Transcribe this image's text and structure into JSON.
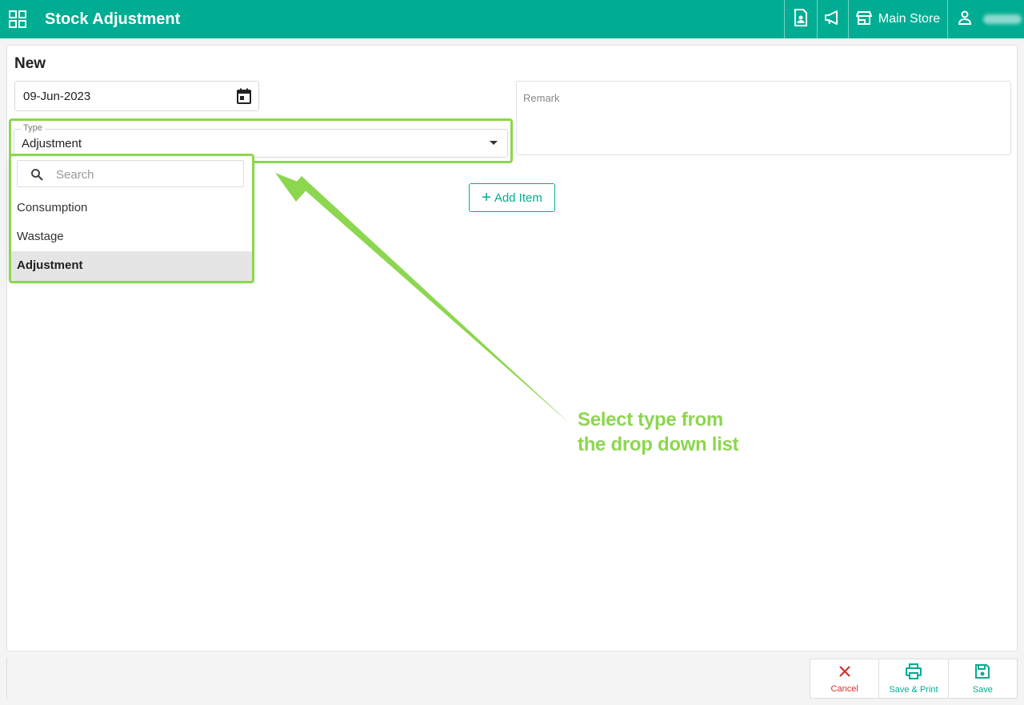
{
  "header": {
    "title": "Stock Adjustment",
    "store": "Main Store",
    "apps_icon": "grid-icon",
    "doc_icon": "document-user-icon",
    "announce_icon": "megaphone-icon",
    "store_icon": "store-icon",
    "user_icon": "user-icon"
  },
  "form": {
    "heading": "New",
    "date_value": "09-Jun-2023",
    "type_label": "Type",
    "type_value": "Adjustment",
    "remark_placeholder": "Remark",
    "search_placeholder": "Search",
    "add_item_label": "Add Item",
    "options": [
      "Consumption",
      "Wastage",
      "Adjustment"
    ],
    "selected_option": "Adjustment"
  },
  "annotation": {
    "line1": "Select type from",
    "line2": "the drop down list",
    "color": "#8dd64f"
  },
  "footer": {
    "cancel": "Cancel",
    "save_print": "Save & Print",
    "save": "Save"
  },
  "colors": {
    "brand": "#00ad92",
    "highlight": "#8dd64f",
    "danger": "#d0312d"
  }
}
